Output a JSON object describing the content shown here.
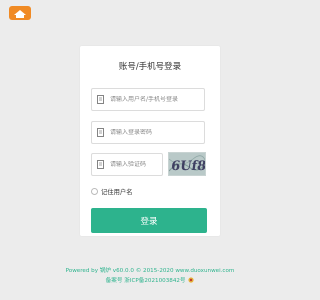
{
  "brand": {
    "accent_color": "#2db38d",
    "logo_color": "#f08a24",
    "logo_icon": "house-logo-icon"
  },
  "login": {
    "title": "账号/手机号登录",
    "username": {
      "placeholder": "请输入用户名/手机号登录",
      "value": "",
      "icon": "user-icon"
    },
    "password": {
      "placeholder": "请输入登录密码",
      "value": "",
      "icon": "lock-icon"
    },
    "captcha": {
      "placeholder": "请输入验证码",
      "value": "",
      "icon": "captcha-icon",
      "image_text": "6Uf8"
    },
    "remember_label": "记住用户名",
    "submit_label": "登录"
  },
  "footer": {
    "powered_prefix": "Powered by ",
    "powered_name": "锅炉",
    "powered_suffix": " v60.0.0 © 2015-2020 www.duoxunwei.com",
    "icp_text": "备案号 浙ICP备2021003842号",
    "police_icon": "police-badge-icon"
  }
}
